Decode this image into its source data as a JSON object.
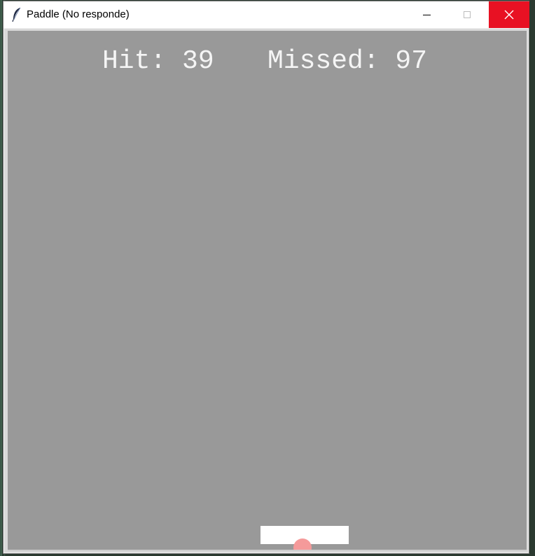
{
  "window": {
    "title": "Paddle (No responde)",
    "icon": "feather-icon",
    "controls": {
      "minimize_icon": "minimize-icon",
      "maximize_icon": "maximize-icon",
      "close_icon": "close-icon",
      "close_color": "#e81123"
    }
  },
  "game": {
    "hit_label": "Hit: 39",
    "missed_label": "Missed: 97",
    "hits": 39,
    "missed": 97,
    "colors": {
      "canvas": "#999999",
      "paddle": "#ffffff",
      "ball": "#f59a9a",
      "text": "#f5f5f5"
    }
  }
}
